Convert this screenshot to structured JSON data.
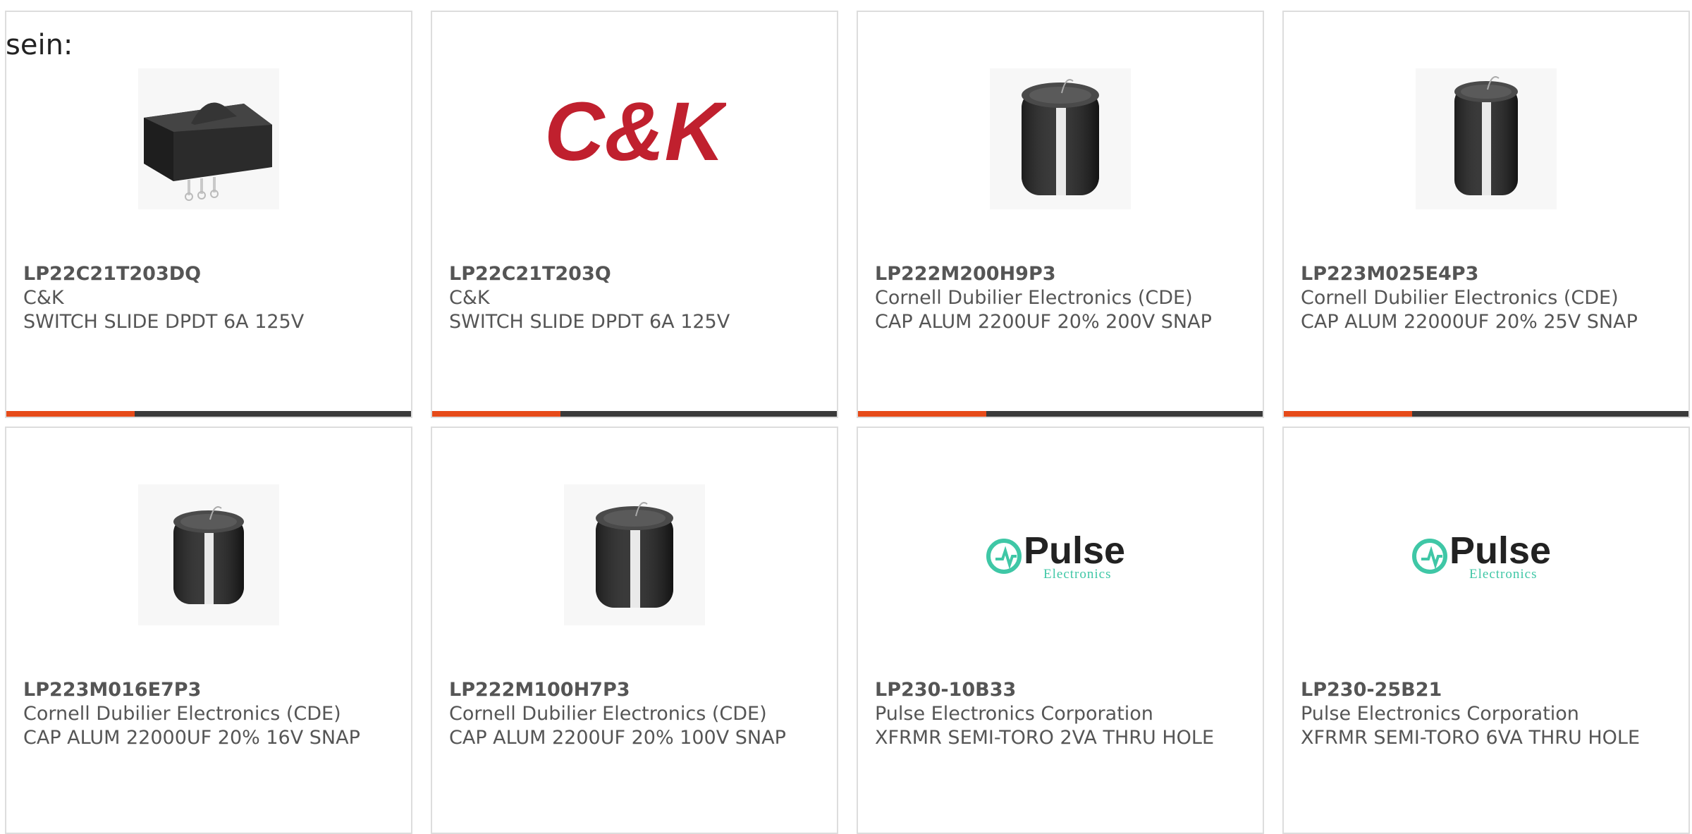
{
  "intro_text": "sein:",
  "colors": {
    "accent": "#e64a19",
    "bar": "#3a3a3a",
    "border": "#dddddd",
    "text": "#555555"
  },
  "products": [
    {
      "part_number": "LP22C21T203DQ",
      "manufacturer": "C&K",
      "description": "SWITCH SLIDE DPDT 6A 125V",
      "image": "switch-image"
    },
    {
      "part_number": "LP22C21T203Q",
      "manufacturer": "C&K",
      "description": "SWITCH SLIDE DPDT 6A 125V",
      "image": "ck-logo"
    },
    {
      "part_number": "LP222M200H9P3",
      "manufacturer": "Cornell Dubilier Electronics (CDE)",
      "description": "CAP ALUM 2200UF 20% 200V SNAP",
      "image": "capacitor-image"
    },
    {
      "part_number": "LP223M025E4P3",
      "manufacturer": "Cornell Dubilier Electronics (CDE)",
      "description": "CAP ALUM 22000UF 20% 25V SNAP",
      "image": "capacitor-image"
    },
    {
      "part_number": "LP223M016E7P3",
      "manufacturer": "Cornell Dubilier Electronics (CDE)",
      "description": "CAP ALUM 22000UF 20% 16V SNAP",
      "image": "capacitor-image"
    },
    {
      "part_number": "LP222M100H7P3",
      "manufacturer": "Cornell Dubilier Electronics (CDE)",
      "description": "CAP ALUM 2200UF 20% 100V SNAP",
      "image": "capacitor-image"
    },
    {
      "part_number": "LP230-10B33",
      "manufacturer": "Pulse Electronics Corporation",
      "description": "XFRMR SEMI-TORO 2VA THRU HOLE",
      "image": "pulse-logo"
    },
    {
      "part_number": "LP230-25B21",
      "manufacturer": "Pulse Electronics Corporation",
      "description": "XFRMR SEMI-TORO 6VA THRU HOLE",
      "image": "pulse-logo"
    }
  ],
  "logos": {
    "ck": "C&K",
    "pulse": "Pulse",
    "pulse_sub": "Electronics"
  }
}
